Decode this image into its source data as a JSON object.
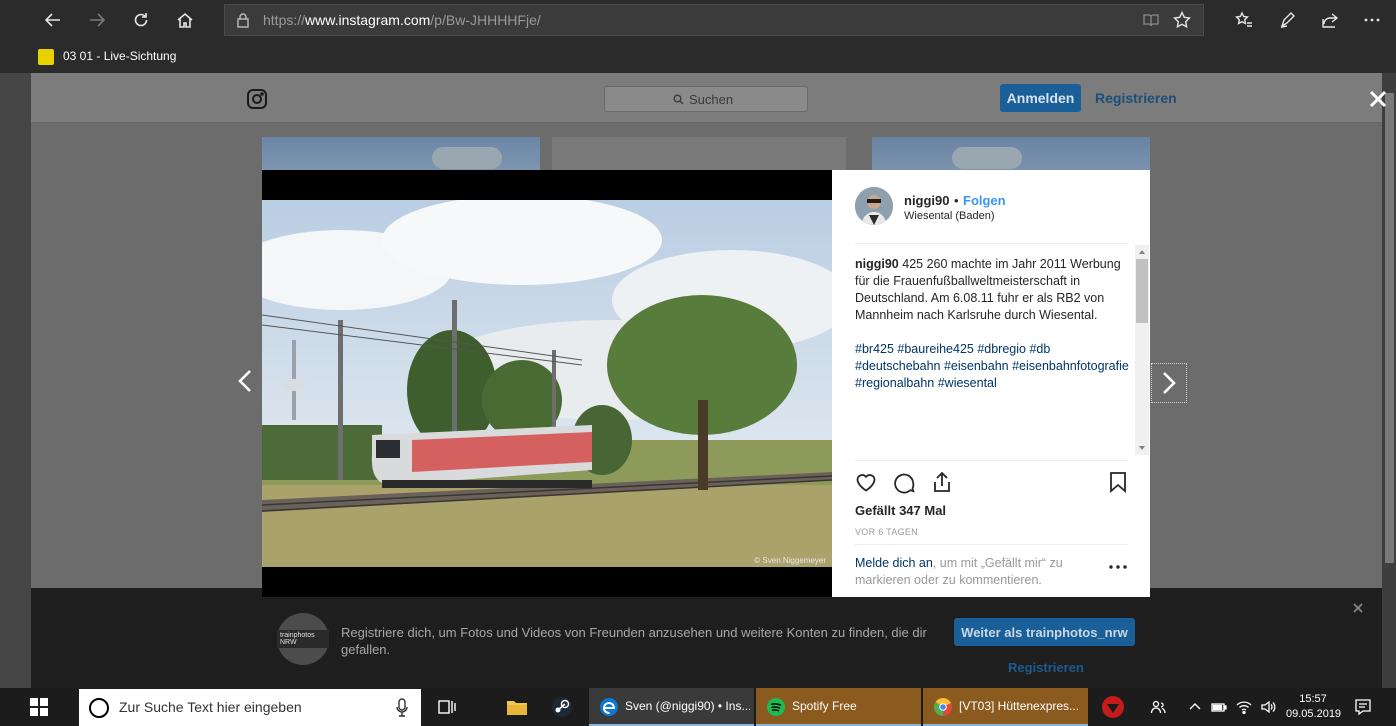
{
  "browser": {
    "url_prefix": "https://",
    "url_host": "www.instagram.com",
    "url_path": "/p/Bw-JHHHHFje/",
    "favorite_label": "03 01 - Live-Sichtung"
  },
  "header": {
    "search_placeholder": "Suchen",
    "login_label": "Anmelden",
    "register_label": "Registrieren"
  },
  "post": {
    "username": "niggi90",
    "dot": "•",
    "follow_label": "Folgen",
    "location": "Wiesental (Baden)",
    "caption_user": "niggi90",
    "caption_text": " 425 260 machte im Jahr 2011 Werbung für die Frauenfußballweltmeisterschaft in Deutschland. Am 6.08.11 fuhr er als RB2 von Mannheim nach Karlsruhe durch Wiesental.",
    "hashtags": "#br425 #baureihe425 #dbregio #db #deutschebahn #eisenbahn #eisenbahnfotografie #regionalbahn #wiesental",
    "likes": "Gefällt 347 Mal",
    "time_ago": "VOR 6 TAGEN",
    "login_link": "Melde dich an",
    "login_rest": ", um mit „Gefällt mir“ zu markieren oder zu kommentieren.",
    "photo_credit": "© Sven Niggemeyer"
  },
  "signup_bar": {
    "message": "Registriere dich, um Fotos und Videos von Freunden anzusehen und weitere Konten zu finden, die dir gefallen.",
    "continue_label": "Weiter als trainphotos_nrw",
    "register_label": "Registrieren",
    "avatar_label": "trainphotos NRW"
  },
  "taskbar": {
    "search_placeholder": "Zur Suche Text hier eingeben",
    "tasks": [
      {
        "label": "Sven (@niggi90) • Ins...",
        "color": "#0a78d4"
      },
      {
        "label": "Spotify Free",
        "color": "#1db954"
      },
      {
        "label": "[VT03] Hüttenexpres...",
        "color": "#dd4b39"
      }
    ],
    "time": "15:57",
    "date": "09.05.2019"
  },
  "colors": {
    "instagram_blue": "#3897f0",
    "hashtag_blue": "#003569",
    "taskbar_bg": "#1c1c1c"
  }
}
